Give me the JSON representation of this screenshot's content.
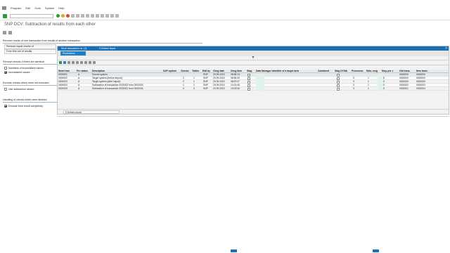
{
  "menu": [
    "Program",
    "Edit",
    "Goto",
    "System",
    "Help"
  ],
  "page_title": "SNP DCV: Subtraction of results from each other",
  "panels": {
    "remove_results": {
      "title": "Remove results of one transaction from results of another transaction",
      "options": [
        "Remove equal results of",
        "From this set of results"
      ]
    },
    "remove_checks": {
      "title": "Remove checks, if there are identical",
      "options": [
        "Numbers of inconsistent values",
        "Inconsistent values"
      ]
    },
    "exclude": {
      "title": "Exclude checks which were not executed",
      "options": [
        "Use subtraction wizard"
      ]
    },
    "handling": {
      "title": "Handling of checks which were aborted",
      "options": [
        "Exclude from result completely"
      ]
    }
  },
  "popup": {
    "title": "Short transaction no. (1)",
    "found_header": "5 Entries found",
    "close": "×",
    "tab": "Restrictions",
    "divider": "▼",
    "status": "5 Entries found",
    "columns": [
      "Short tran",
      "Prc status",
      "Description",
      "SAP system",
      "Checks",
      "Tables",
      "Edit by",
      "Chng date",
      "Chng time",
      "Stag.",
      "Data Manager Identifier of a target area",
      "Combined",
      "Stag.ChTab",
      "Processes",
      "Miss. msg",
      "Msg. per v",
      "Old trans.",
      "New trans."
    ],
    "rows": [
      {
        "id": "0000001",
        "status": "A",
        "desc": "Source system",
        "sys": "",
        "checks": "",
        "tables": "",
        "editby": "SNP",
        "date": "20.09.2019",
        "time": "08:55:13",
        "combined": "",
        "proc": "",
        "miss": "",
        "msg": "",
        "old": "0000000",
        "new": "0000000"
      },
      {
        "id": "0000002",
        "status": "A",
        "desc": "Target system (before import)",
        "sys": "",
        "checks": "2",
        "tables": "1",
        "editby": "SNP",
        "date": "20.09.2019",
        "time": "08:56:33",
        "combined": "",
        "proc": "3",
        "miss": "1",
        "msg": "0",
        "old": "0000000",
        "new": "0000000"
      },
      {
        "id": "0000003",
        "status": "A",
        "desc": "Target system (after import)",
        "sys": "",
        "checks": "2",
        "tables": "1",
        "editby": "SNP",
        "date": "20.09.2019",
        "time": "08:57:07",
        "combined": "",
        "proc": "3",
        "miss": "1",
        "msg": "0",
        "old": "0000000",
        "new": "0000000"
      },
      {
        "id": "0000004",
        "status": "A",
        "desc": "Subtraction of transaction 0000002 from 0000003.",
        "sys": "",
        "checks": "1",
        "tables": "1",
        "editby": "SNP",
        "date": "20.09.2019",
        "time": "10:01:46",
        "combined": "",
        "proc": "3",
        "miss": "1",
        "msg": "0",
        "old": "0000002",
        "new": "0000003"
      },
      {
        "id": "0000005",
        "status": "A",
        "desc": "Subtraction of transaction 0000002 from 0000004.",
        "sys": "",
        "checks": "0",
        "tables": "0",
        "editby": "SNP",
        "date": "20.09.2019",
        "time": "10:03:50",
        "combined": "",
        "proc": "3",
        "miss": "1",
        "msg": "0",
        "old": "0000001",
        "new": "0000004"
      }
    ]
  },
  "colors": {
    "accent": "#1d6fb3",
    "ok": "#2e9b3a",
    "exec": "#27a243",
    "cancel": "#e0a81a",
    "stop": "#d6452e"
  }
}
